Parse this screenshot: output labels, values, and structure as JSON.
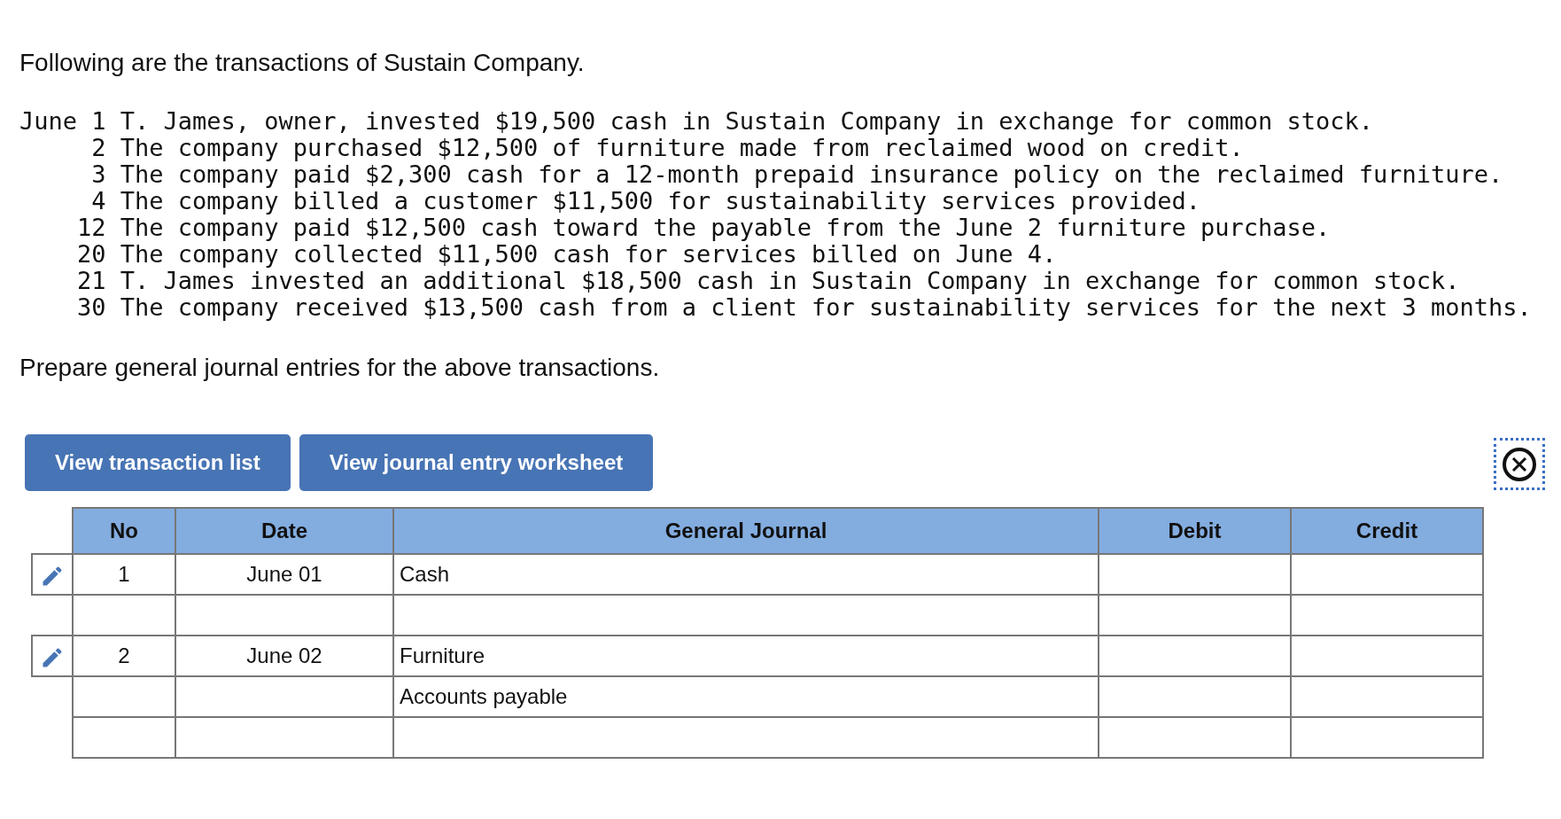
{
  "intro": "Following are the transactions of Sustain Company.",
  "transactions": [
    {
      "day": "June 1",
      "text": "T. James, owner, invested $19,500 cash in Sustain Company in exchange for common stock."
    },
    {
      "day": "2",
      "text": "The company purchased $12,500 of furniture made from reclaimed wood on credit."
    },
    {
      "day": "3",
      "text": "The company paid $2,300 cash for a 12-month prepaid insurance policy on the reclaimed furniture."
    },
    {
      "day": "4",
      "text": "The company billed a customer $11,500 for sustainability services provided."
    },
    {
      "day": "12",
      "text": "The company paid $12,500 cash toward the payable from the June 2 furniture purchase."
    },
    {
      "day": "20",
      "text": "The company collected $11,500 cash for services billed on June 4."
    },
    {
      "day": "21",
      "text": "T. James invested an additional $18,500 cash in Sustain Company in exchange for common stock."
    },
    {
      "day": "30",
      "text": "The company received $13,500 cash from a client for sustainability services for the next 3 months."
    }
  ],
  "instruction": "Prepare general journal entries for the above transactions.",
  "buttons": [
    "View transaction list",
    "View journal entry worksheet"
  ],
  "table": {
    "columns": [
      "No",
      "Date",
      "General Journal",
      "Debit",
      "Credit"
    ],
    "rows": [
      {
        "editable": true,
        "no": "1",
        "date": "June 01",
        "account": "Cash"
      },
      {
        "editable": false
      },
      {
        "editable": true,
        "no": "2",
        "date": "June 02",
        "account": "Furniture"
      },
      {
        "editable": false,
        "account": "Accounts payable"
      },
      {
        "editable": false
      }
    ]
  }
}
